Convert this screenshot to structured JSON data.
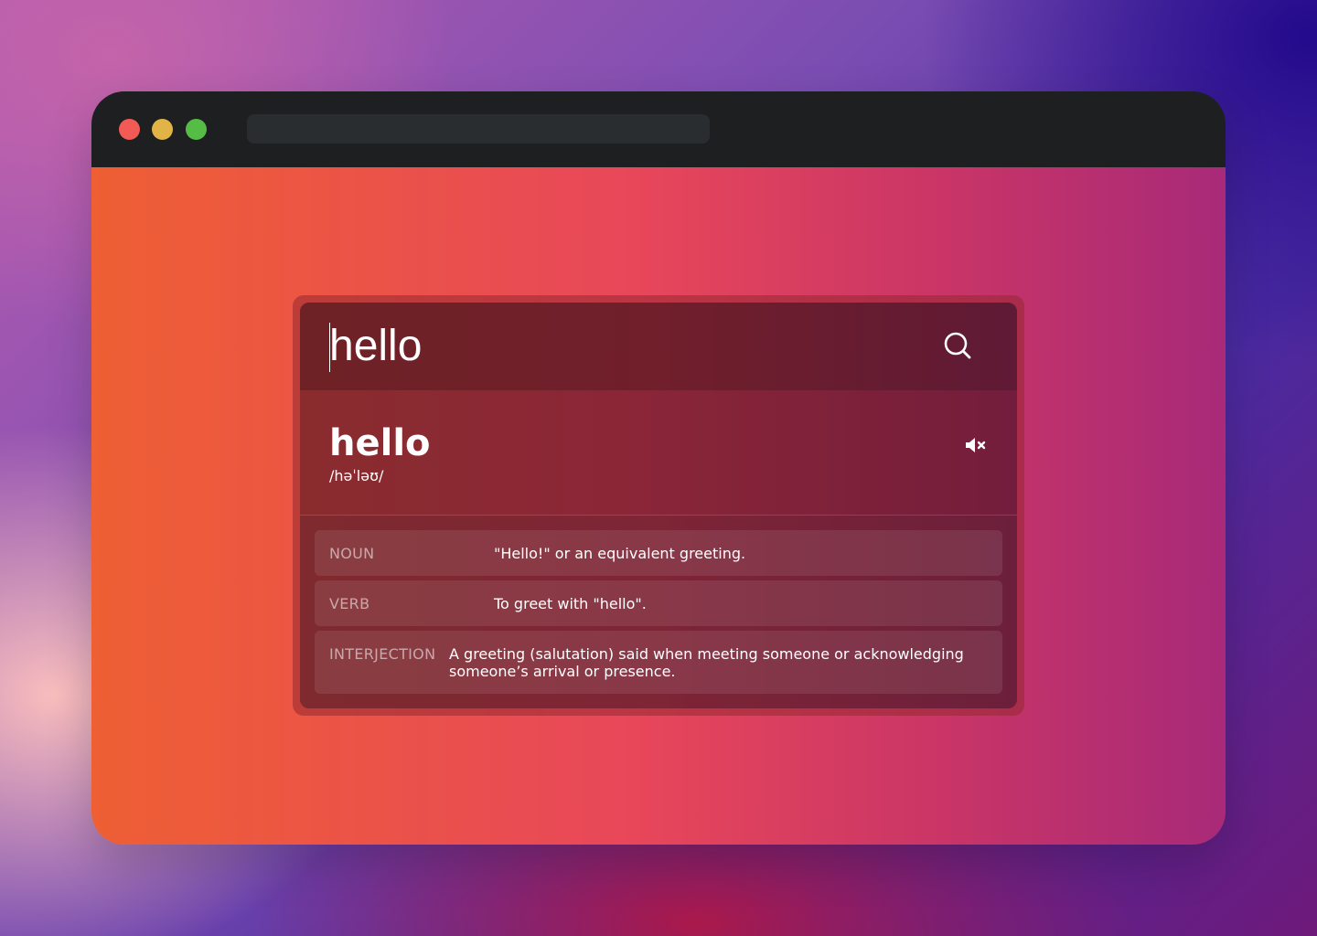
{
  "window": {
    "controls": [
      "close",
      "minimize",
      "zoom"
    ],
    "address_bar_text": ""
  },
  "search": {
    "value": "hello",
    "icon": "search-icon"
  },
  "entry": {
    "word": "hello",
    "phonetic": "/həˈləʊ/",
    "audio_icon": "speaker-muted-icon"
  },
  "definitions": [
    {
      "part_of_speech": "NOUN",
      "meaning": "\"Hello!\" or an equivalent greeting."
    },
    {
      "part_of_speech": "VERB",
      "meaning": "To greet with \"hello\"."
    },
    {
      "part_of_speech": "INTERJECTION",
      "meaning": "A greeting (salutation) said when meeting someone or acknowledging someone’s arrival or presence."
    }
  ],
  "colors": {
    "close": "#f25a55",
    "minimize": "#e2b446",
    "zoom": "#55bd45",
    "titlebar": "#1e1f21"
  }
}
